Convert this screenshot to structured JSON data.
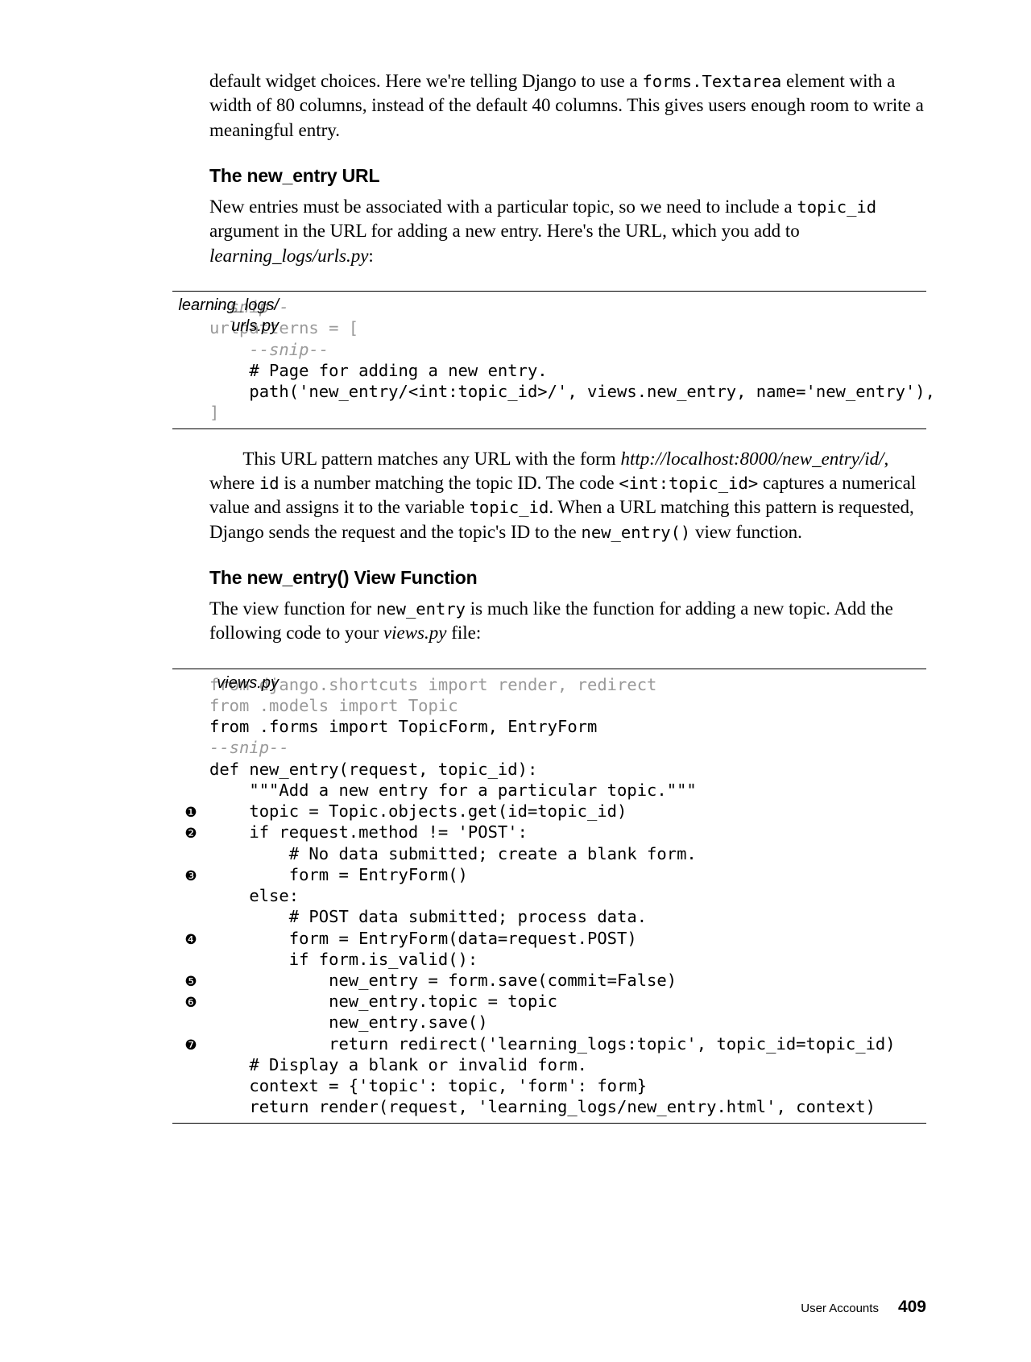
{
  "para1": {
    "prefix": "default widget choices. Here we're telling Django to use a ",
    "code": "forms.Textarea",
    "suffix": " element with a width of 80 columns, instead of the default 40 columns. This gives users enough room to write a meaningful entry."
  },
  "heading1": "The new_entry URL",
  "para2": {
    "t1": "New entries must be associated with a particular topic, so we need to include a ",
    "c1": "topic_id",
    "t2": " argument in the URL for adding a new entry. Here's the URL, which you add to ",
    "f1": "learning_logs/urls.py",
    "t3": ":"
  },
  "code1": {
    "label1": "learning_logs/",
    "label2": "urls.py",
    "lines": {
      "l1": "--snip--",
      "l2": "urlpatterns = [",
      "l3": "    --snip--",
      "l4": "    # Page for adding a new entry.",
      "l5": "    path('new_entry/<int:topic_id>/', views.new_entry, name='new_entry'),",
      "l6": "]"
    }
  },
  "para3": {
    "t1": "This URL pattern matches any URL with the form ",
    "f1": "http://localhost:8000/new_entry/id/",
    "t2": ", where ",
    "c1": "id",
    "t3": " is a number matching the topic ID. The code ",
    "c2": "<int:topic_id>",
    "t4": " captures a numerical value and assigns it to the variable ",
    "c3": "topic_id",
    "t5": ". When a URL matching this pattern is requested, Django sends the request and the topic's ID to the ",
    "c4": "new_entry()",
    "t6": " view function."
  },
  "heading2": "The new_entry() View Function",
  "para4": {
    "t1": "The view function for ",
    "c1": "new_entry",
    "t2": " is much like the function for adding a new topic. Add the following code to your ",
    "f1": "views.py",
    "t3": " file:"
  },
  "code2": {
    "label": "views.py",
    "callouts": {
      "n1": "❶",
      "n2": "❷",
      "n3": "❸",
      "n4": "❹",
      "n5": "❺",
      "n6": "❻",
      "n7": "❼"
    },
    "lines": {
      "l01": "from django.shortcuts import render, redirect",
      "l02": "",
      "l03": "from .models import Topic",
      "l04": "from .forms import TopicForm, EntryForm",
      "l05": "",
      "l06": "--snip--",
      "l07": "def new_entry(request, topic_id):",
      "l08": "    \"\"\"Add a new entry for a particular topic.\"\"\"",
      "l09": "    topic = Topic.objects.get(id=topic_id)",
      "l10": "",
      "l11": "    if request.method != 'POST':",
      "l12": "        # No data submitted; create a blank form.",
      "l13": "        form = EntryForm()",
      "l14": "    else:",
      "l15": "        # POST data submitted; process data.",
      "l16": "        form = EntryForm(data=request.POST)",
      "l17": "        if form.is_valid():",
      "l18": "            new_entry = form.save(commit=False)",
      "l19": "            new_entry.topic = topic",
      "l20": "            new_entry.save()",
      "l21": "            return redirect('learning_logs:topic', topic_id=topic_id)",
      "l22": "",
      "l23": "    # Display a blank or invalid form.",
      "l24": "    context = {'topic': topic, 'form': form}",
      "l25": "    return render(request, 'learning_logs/new_entry.html', context)"
    }
  },
  "footer": {
    "title": "User Accounts",
    "page": "409"
  }
}
